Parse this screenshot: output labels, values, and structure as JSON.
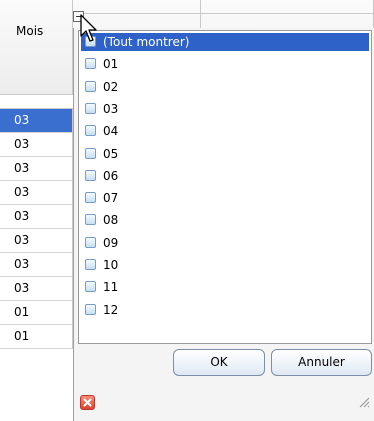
{
  "grid": {
    "column_header": "Mois",
    "rows": [
      {
        "value": "03",
        "selected": true
      },
      {
        "value": "03",
        "selected": false
      },
      {
        "value": "03",
        "selected": false
      },
      {
        "value": "03",
        "selected": false
      },
      {
        "value": "03",
        "selected": false
      },
      {
        "value": "03",
        "selected": false
      },
      {
        "value": "03",
        "selected": false
      },
      {
        "value": "03",
        "selected": false
      },
      {
        "value": "01",
        "selected": false
      },
      {
        "value": "01",
        "selected": false
      }
    ]
  },
  "filter": {
    "items": [
      {
        "label": "(Tout montrer)",
        "checked": false,
        "selected": true
      },
      {
        "label": "01",
        "checked": false,
        "selected": false
      },
      {
        "label": "02",
        "checked": false,
        "selected": false
      },
      {
        "label": "03",
        "checked": false,
        "selected": false
      },
      {
        "label": "04",
        "checked": false,
        "selected": false
      },
      {
        "label": "05",
        "checked": false,
        "selected": false
      },
      {
        "label": "06",
        "checked": false,
        "selected": false
      },
      {
        "label": "07",
        "checked": false,
        "selected": false
      },
      {
        "label": "08",
        "checked": false,
        "selected": false
      },
      {
        "label": "09",
        "checked": false,
        "selected": false
      },
      {
        "label": "10",
        "checked": false,
        "selected": false
      },
      {
        "label": "11",
        "checked": false,
        "selected": false
      },
      {
        "label": "12",
        "checked": false,
        "selected": false
      }
    ],
    "ok_label": "OK",
    "cancel_label": "Annuler",
    "icons": {
      "filter_button": "filter-dropdown-icon",
      "close": "close-icon",
      "resize": "resize-grip-icon",
      "cursor": "mouse-pointer-icon"
    }
  },
  "colors": {
    "selection": "#2f62c9",
    "cell_selection": "#3a6fd0",
    "close_button": "#d9432f"
  }
}
